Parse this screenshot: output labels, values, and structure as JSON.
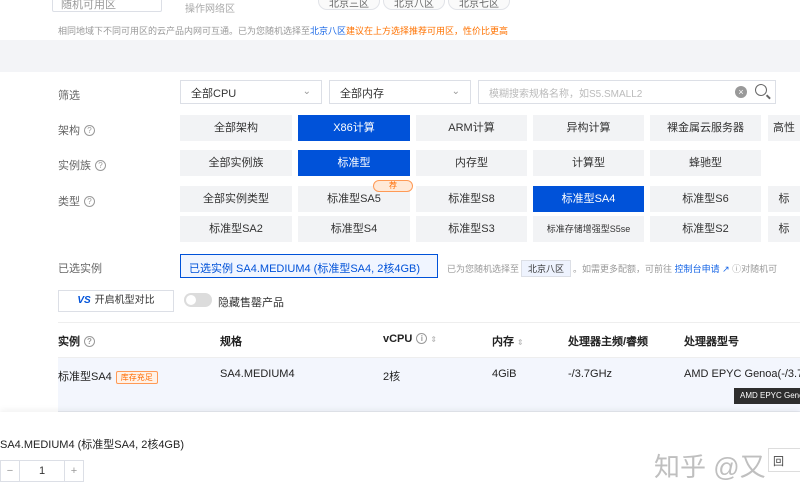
{
  "zone": {
    "select_value": "随机可用区",
    "hint": "操作网络区",
    "chips": [
      "北京三区",
      "北京八区",
      "北京七区"
    ]
  },
  "tipline": {
    "part1": "相同地域下不同可用区的云产品内网可互通。已为您随机选择至",
    "zone": "北京八区",
    "part2": "建议在上方选择推荐可用区，",
    "part3": "性价比更高"
  },
  "filter": {
    "label": "筛选",
    "cpu_select": "全部CPU",
    "mem_select": "全部内存",
    "search_placeholder": "模糊搜索规格名称，如S5.SMALL2"
  },
  "arch": {
    "label": "架构",
    "options": [
      "全部架构",
      "X86计算",
      "ARM计算",
      "异构计算",
      "裸金属云服务器",
      "高性"
    ]
  },
  "family": {
    "label": "实例族",
    "options": [
      "全部实例族",
      "标准型",
      "内存型",
      "计算型",
      "蜂驰型"
    ]
  },
  "type": {
    "label": "类型",
    "badge": "荐",
    "row1": [
      "全部实例类型",
      "标准型SA5",
      "标准型S8",
      "标准型SA4",
      "标准型S6",
      "标"
    ],
    "row2": [
      "标准型SA2",
      "标准型S4",
      "标准型S3",
      "标准存储增强型S5se",
      "标准型S2",
      "标"
    ]
  },
  "selected": {
    "label": "已选实例",
    "value": "已选实例  SA4.MEDIUM4 (标准型SA4, 2核4GB)",
    "hint1": "已为您随机选择至",
    "zone_chip": "北京八区",
    "hint2": "。如需更多配额，可前往",
    "link": "控制台申请",
    "hint3": "对随机可"
  },
  "compare_button": {
    "vs": "VS",
    "label": "开启机型对比"
  },
  "toggle_label": "隐藏售罄产品",
  "table": {
    "headers": {
      "instance": "实例",
      "spec": "规格",
      "vcpu": "vCPU",
      "memory": "内存",
      "freq": "处理器主频/睿频",
      "model": "处理器型号"
    },
    "row": {
      "instance": "标准型SA4",
      "stock_badge": "库存充足",
      "spec": "SA4.MEDIUM4",
      "vcpu": "2核",
      "memory": "4GiB",
      "freq": "-/3.7GHz",
      "model": "AMD EPYC Genoa(-/3.7"
    },
    "tooltip": "AMD EPYC Genoa"
  },
  "footer": {
    "spec": "SA4.MEDIUM4 (标准型SA4, 2核4GB)",
    "stepper": {
      "minus": "−",
      "value": "1",
      "plus": "+"
    },
    "watermark": "知乎 @又",
    "chat_label": "回"
  }
}
